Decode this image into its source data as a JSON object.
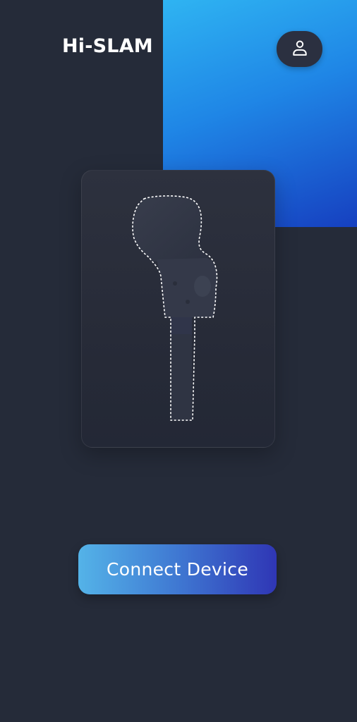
{
  "header": {
    "app_title": "Hi-SLAM",
    "profile_icon": "user-icon"
  },
  "device_card": {
    "illustration_icon": "handheld-scanner-icon"
  },
  "actions": {
    "connect_label": "Connect Device"
  },
  "colors": {
    "background": "#252b39",
    "accent_start": "#2fb4f2",
    "accent_end": "#1640c0",
    "button_start": "#54b3e8",
    "button_end": "#2f36b5"
  }
}
